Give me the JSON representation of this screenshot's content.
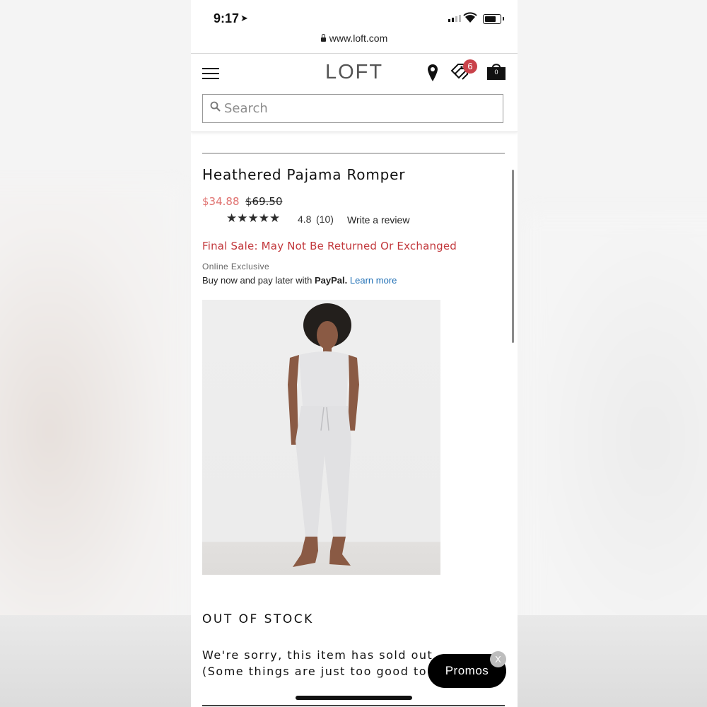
{
  "status_bar": {
    "time": "9:17",
    "url": "www.loft.com"
  },
  "header": {
    "logo": "LOFT",
    "offers_badge": "6",
    "bag_count": "0",
    "search_placeholder": "Search"
  },
  "product": {
    "title": "Heathered Pajama Romper",
    "sale_price": "$34.88",
    "original_price": "$69.50",
    "stars": "★★★★★",
    "rating": "4.8",
    "review_count": "(10)",
    "write_review_label": "Write a review",
    "final_sale_notice": "Final Sale: May Not Be Returned Or Exchanged",
    "online_exclusive": "Online Exclusive",
    "paypal_prefix": "Buy now and pay later with",
    "paypal_brand": "PayPal.",
    "learn_more_label": "Learn more"
  },
  "stock": {
    "heading": "OUT OF STOCK",
    "message_line1": "We're sorry, this item has sold out.",
    "message_line2": "(Some things are just too good to"
  },
  "promos": {
    "label": "Promos",
    "close_label": "X"
  },
  "colors": {
    "sale_price": "#e0716f",
    "final_sale": "#c2373b",
    "badge": "#c9424a",
    "link": "#1f6fb5"
  }
}
